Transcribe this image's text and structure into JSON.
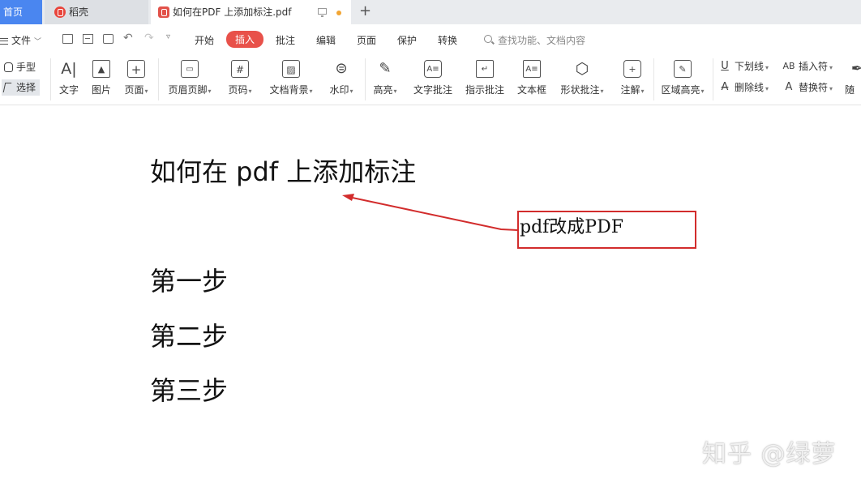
{
  "tabs": {
    "home": "首页",
    "daoke": "稻壳",
    "document": "如何在PDF 上添加标注.pdf"
  },
  "menubar": {
    "file_menu": "文件",
    "items": [
      "开始",
      "插入",
      "批注",
      "编辑",
      "页面",
      "保护",
      "转换"
    ],
    "active_item": "插入",
    "search_placeholder": "查找功能、文档内容"
  },
  "ribbon": {
    "hand_mode": "手型",
    "select_mode": "选择",
    "text": "文字",
    "image": "图片",
    "page": "页面",
    "header_footer": "页眉页脚",
    "page_number": "页码",
    "doc_background": "文档背景",
    "watermark": "水印",
    "highlight": "高亮",
    "text_comment": "文字批注",
    "pointer_comment": "指示批注",
    "text_box": "文本框",
    "shape_comment": "形状批注",
    "annotation": "注解",
    "area_highlight": "区域高亮",
    "underline": "下划线",
    "insert_symbol": "插入符",
    "strikethrough": "删除线",
    "replace_symbol": "替换符",
    "freehand": "随"
  },
  "document": {
    "title": "如何在 pdf 上添加标注",
    "note": "pdf改成PDF",
    "steps": [
      "第一步",
      "第二步",
      "第三步"
    ],
    "watermark": "知乎 @绿萝"
  },
  "colors": {
    "home_tab": "#4a86f0",
    "active_menu": "#e8514a",
    "annotation_red": "#d22c2c"
  }
}
